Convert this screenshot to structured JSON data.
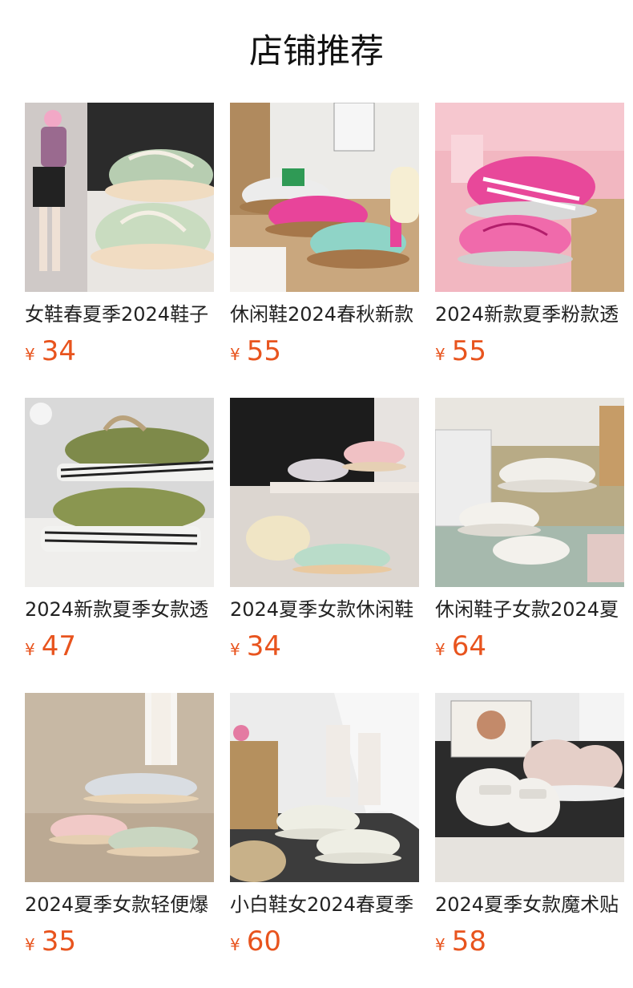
{
  "header": {
    "title": "店铺推荐"
  },
  "currency_symbol": "¥",
  "colors": {
    "price": "#e8541e",
    "title": "#111111",
    "text": "#222222"
  },
  "products": [
    {
      "name": "女鞋春夏季2024鞋子",
      "price": "34",
      "image": "sneaker-photo-green-pair"
    },
    {
      "name": "休闲鞋2024春秋新款",
      "price": "55",
      "image": "sneaker-photo-colorful-trio"
    },
    {
      "name": "2024新款夏季粉款透",
      "price": "55",
      "image": "sneaker-photo-pink-pair"
    },
    {
      "name": "2024新款夏季女款透",
      "price": "47",
      "image": "sneaker-photo-olive-canvas"
    },
    {
      "name": "2024夏季女款休闲鞋",
      "price": "34",
      "image": "sneaker-photo-pastel-display"
    },
    {
      "name": "休闲鞋子女款2024夏",
      "price": "64",
      "image": "sneaker-photo-white-pair"
    },
    {
      "name": "2024夏季女款轻便爆",
      "price": "35",
      "image": "sneaker-photo-grey-pink-trio"
    },
    {
      "name": "小白鞋女2024春夏季",
      "price": "60",
      "image": "sneaker-photo-white-worn"
    },
    {
      "name": "2024夏季女款魔术贴",
      "price": "58",
      "image": "sneaker-photo-velcro-pair"
    }
  ]
}
